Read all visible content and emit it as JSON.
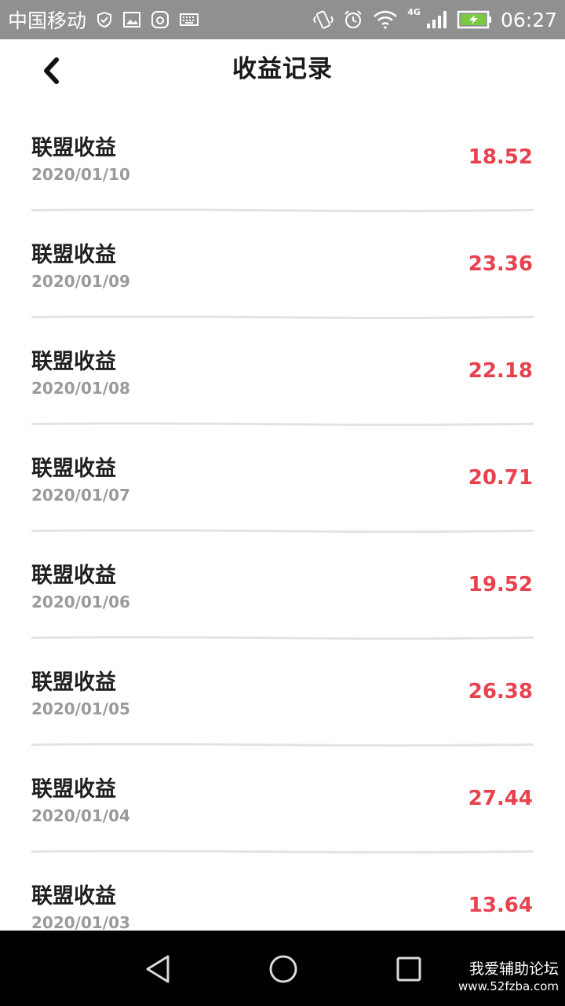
{
  "status_bar": {
    "carrier": "中国移动",
    "network": "4G",
    "time": "06:27"
  },
  "header": {
    "title": "收益记录"
  },
  "records": [
    {
      "title": "联盟收益",
      "date": "2020/01/10",
      "amount": "18.52"
    },
    {
      "title": "联盟收益",
      "date": "2020/01/09",
      "amount": "23.36"
    },
    {
      "title": "联盟收益",
      "date": "2020/01/08",
      "amount": "22.18"
    },
    {
      "title": "联盟收益",
      "date": "2020/01/07",
      "amount": "20.71"
    },
    {
      "title": "联盟收益",
      "date": "2020/01/06",
      "amount": "19.52"
    },
    {
      "title": "联盟收益",
      "date": "2020/01/05",
      "amount": "26.38"
    },
    {
      "title": "联盟收益",
      "date": "2020/01/04",
      "amount": "27.44"
    },
    {
      "title": "联盟收益",
      "date": "2020/01/03",
      "amount": "13.64"
    }
  ],
  "watermark": {
    "line1": "我爱辅助论坛",
    "line2": "www.52fzba.com"
  },
  "colors": {
    "amount": "#e8424e",
    "status_bar": "#909090",
    "nav_bar": "#000000"
  }
}
